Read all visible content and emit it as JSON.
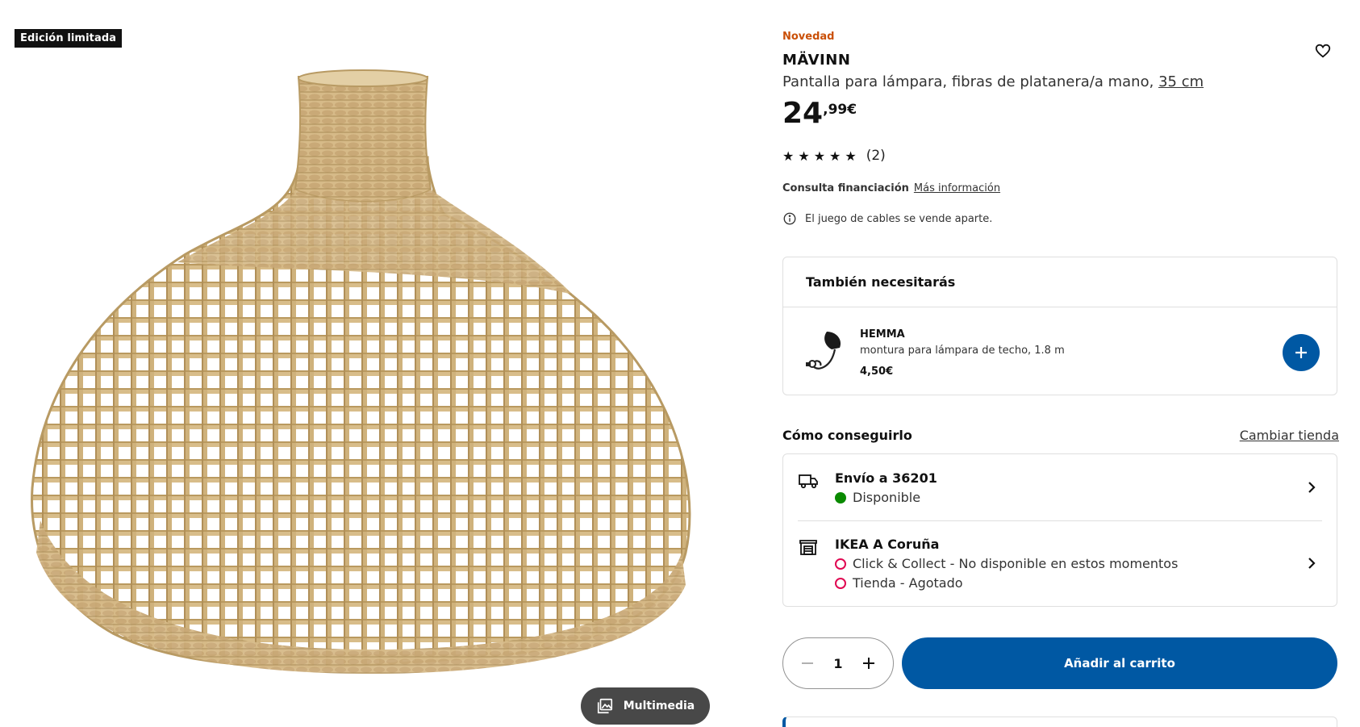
{
  "gallery": {
    "badge": "Edición limitada",
    "multimedia_label": "Multimedia"
  },
  "product": {
    "new_label": "Novedad",
    "name": "MÄVINN",
    "description": "Pantalla para lámpara, fibras de platanera/a mano,",
    "size": "35 cm",
    "price_int": "24",
    "price_dec": ",99€",
    "rating_count": "(2)",
    "rating_value": 5,
    "financing_label": "Consulta financiación",
    "financing_link": "Más información",
    "cable_note": "El juego de cables se vende aparte."
  },
  "also_needed": {
    "title": "También necesitarás",
    "item_name": "HEMMA",
    "item_desc": "montura para lámpara de techo, 1.8 m",
    "item_price": "4,50€"
  },
  "availability": {
    "title": "Cómo conseguirlo",
    "change_store": "Cambiar tienda",
    "delivery_title": "Envío a 36201",
    "delivery_status": "Disponible",
    "store_title": "IKEA A Coruña",
    "store_status_1": "Click & Collect - No disponible en estos momentos",
    "store_status_2": "Tienda - Agotado"
  },
  "purchase": {
    "quantity": "1",
    "add_to_cart": "Añadir al carrito"
  },
  "colors": {
    "brand_blue": "#0058a3",
    "new_orange": "#ca5008",
    "available_green": "#0a8a00",
    "unavailable_red": "#e00751"
  }
}
